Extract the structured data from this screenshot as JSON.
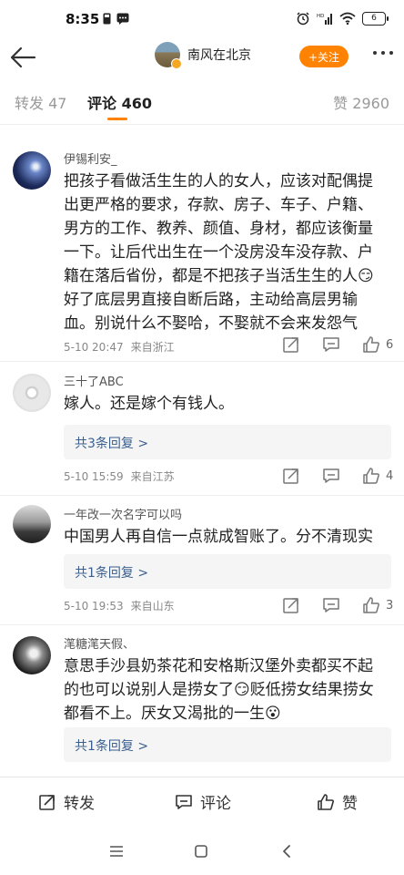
{
  "status": {
    "time": "8:35",
    "battery": "6"
  },
  "nav": {
    "username": "南风在北京",
    "follow_label": "+关注"
  },
  "tabs": {
    "forward_label": "转发",
    "forward_count": "47",
    "comments_label": "评论",
    "comments_count": "460",
    "likes_label": "赞",
    "likes_count": "2960",
    "active_color": "#ff8200"
  },
  "comments": [
    {
      "name": "伊锡利安_",
      "text": "把孩子看做活生生的人的女人，应该对配偶提出更严格的要求，存款、房子、车子、户籍、男方的工作、教养、颜值、身材，都应该衡量一下。让后代出生在一个没房没车没存款、户籍在落后省份，都是不把孩子当活生生的人😏好了底层男直接自断后路，主动给高层男输血。别说什么不娶哈，不娶就不会来发怨气",
      "time": "5-10 20:47",
      "location": "来自浙江",
      "likes": "6"
    },
    {
      "name": "三十了ABC",
      "text": "嫁人。还是嫁个有钱人。",
      "replies": "共3条回复 >",
      "time": "5-10 15:59",
      "location": "来自江苏",
      "likes": "4"
    },
    {
      "name": "一年改一次名字可以吗",
      "text": "中国男人再自信一点就成智账了。分不清现实",
      "replies": "共1条回复 >",
      "time": "5-10 19:53",
      "location": "来自山东",
      "likes": "3"
    },
    {
      "name": "滗糖滗天假、",
      "text": "意思手沙县奶茶花和安格斯汉堡外卖都买不起的也可以说别人是捞女了😏贬低捞女结果捞女都看不上。厌女又渴批的一生😮",
      "replies": "共1条回复 >"
    }
  ],
  "bottom": {
    "forward": "转发",
    "comment": "评论",
    "like": "赞"
  },
  "icons": {
    "back": "back-arrow-icon",
    "more": "more-dots-icon",
    "share": "share-icon",
    "comment": "comment-icon",
    "like": "thumbs-up-icon"
  }
}
